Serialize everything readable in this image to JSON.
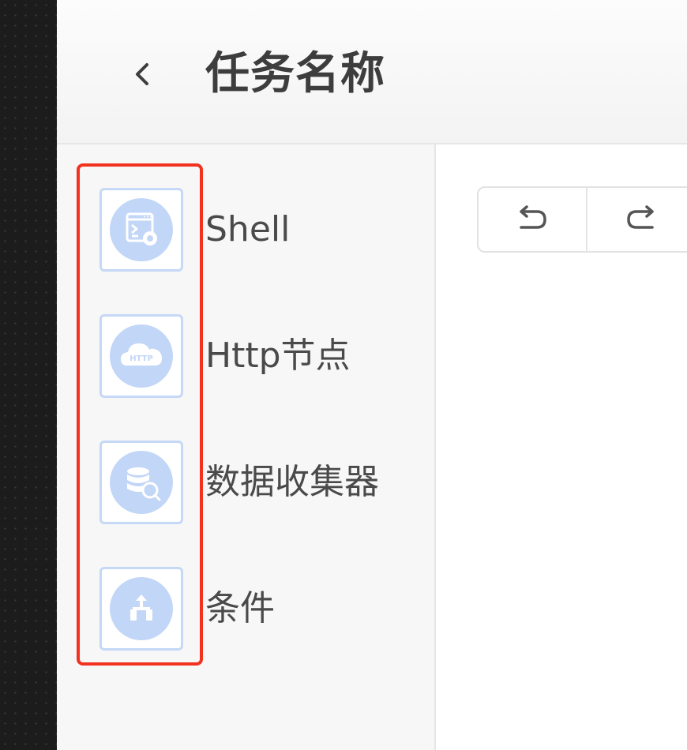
{
  "header": {
    "back_icon": "chevron-left-icon",
    "title": "任务名称"
  },
  "sidebar": {
    "highlight_color": "#f2321f",
    "tile_color": "#c2d6f7",
    "items": [
      {
        "label": "Shell",
        "icon": "terminal-settings-icon"
      },
      {
        "label": "Http节点",
        "icon": "cloud-http-icon",
        "icon_text": "HTTP"
      },
      {
        "label": "数据收集器",
        "icon": "database-search-icon"
      },
      {
        "label": "条件",
        "icon": "branch-icon"
      }
    ]
  },
  "toolbar": {
    "undo_icon": "undo-icon",
    "redo_icon": "redo-icon"
  }
}
